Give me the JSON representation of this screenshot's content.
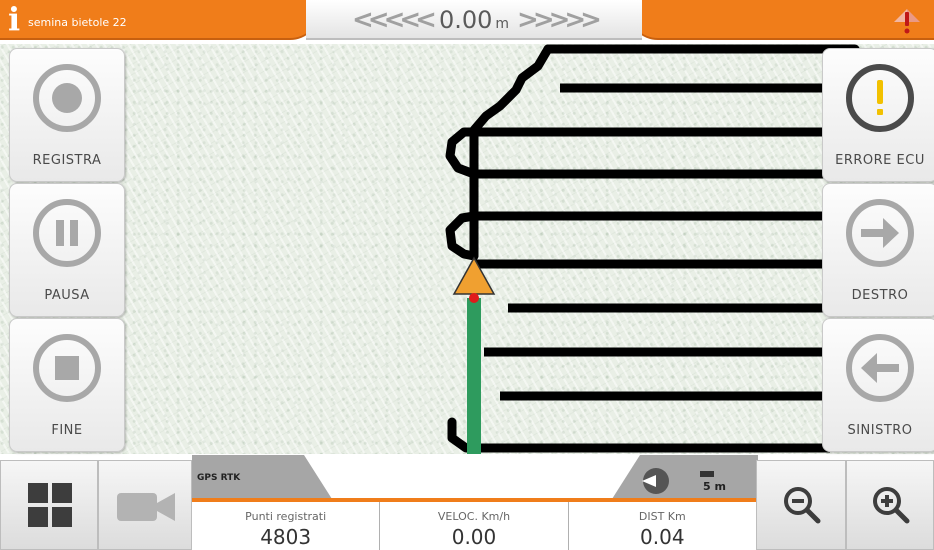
{
  "header": {
    "job_name": "semina bietole 22",
    "offset_value": "0.00",
    "offset_unit": "m",
    "accent_color": "#f07d1a"
  },
  "side_buttons": {
    "record": {
      "label": "REGISTRA",
      "icon": "record-icon"
    },
    "pause": {
      "label": "PAUSA",
      "icon": "pause-icon"
    },
    "stop": {
      "label": "FINE",
      "icon": "stop-icon"
    },
    "ecu_error": {
      "label": "ERRORE ECU",
      "icon": "warning-icon",
      "icon_color": "#f2c100"
    },
    "right": {
      "label": "DESTRO",
      "icon": "arrow-right-icon"
    },
    "left": {
      "label": "SINISTRO",
      "icon": "arrow-left-icon"
    }
  },
  "map": {
    "gps_mode": "GPS RTK",
    "scale": "5 m",
    "guidance_color": "#2e9b5e",
    "vehicle_color": "#f0a030"
  },
  "status": [
    {
      "title": "Punti registrati",
      "value": "4803"
    },
    {
      "title": "VELOC. Km/h",
      "value": "0.00"
    },
    {
      "title": "DIST Km",
      "value": "0.04"
    }
  ],
  "bottom_buttons": {
    "layout": "grid-icon",
    "camera": "camera-icon",
    "zoom_out": "zoom-out-icon",
    "zoom_in": "zoom-in-icon"
  }
}
